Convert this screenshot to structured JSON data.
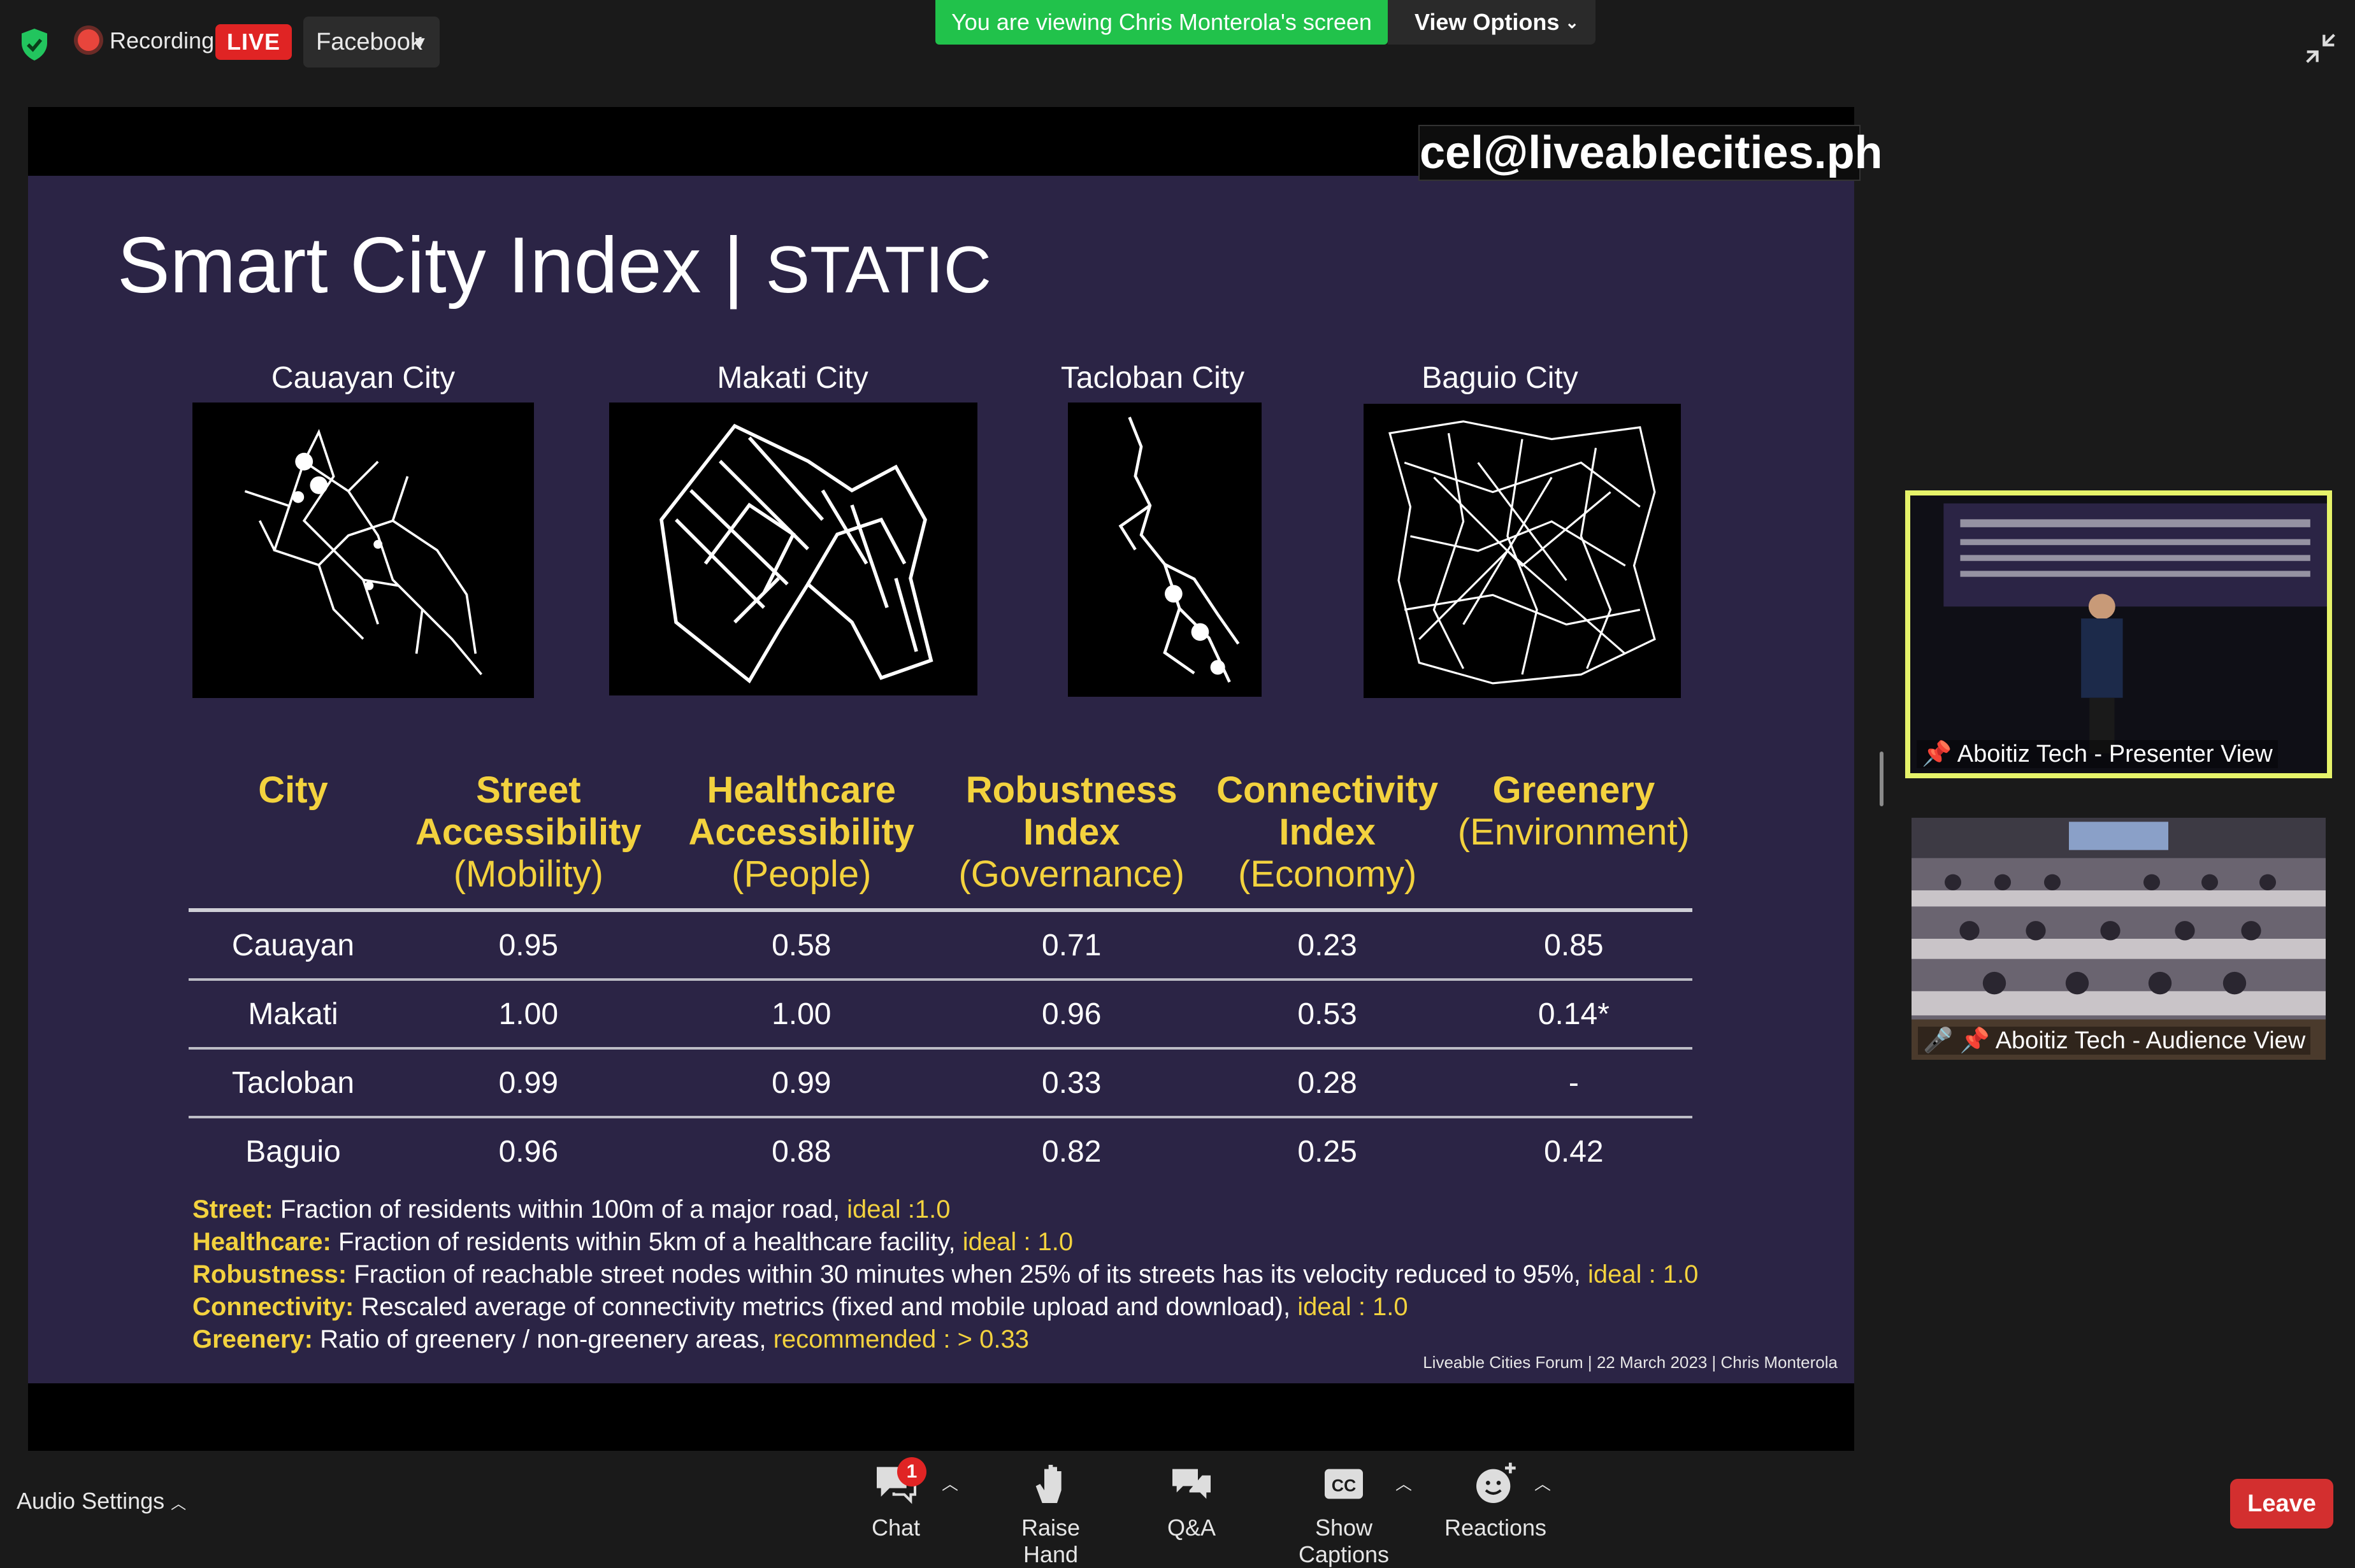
{
  "topbar": {
    "recording_label": "Recording",
    "live_label": "LIVE",
    "stream_target": "Facebook",
    "viewing_banner": "You are viewing Chris Monterola's screen",
    "view_options_label": "View Options"
  },
  "slide": {
    "email": "cel@liveablecities.ph",
    "title_main": "Smart City Index | ",
    "title_sub": "STATIC",
    "maps": [
      {
        "label": "Cauayan City"
      },
      {
        "label": "Makati City"
      },
      {
        "label": "Tacloban City"
      },
      {
        "label": "Baguio City"
      }
    ],
    "table": {
      "headers": [
        {
          "name": "City",
          "unit": ""
        },
        {
          "name": "Street Accessibility",
          "unit": "(Mobility)"
        },
        {
          "name": "Healthcare Accessibility",
          "unit": "(People)"
        },
        {
          "name": "Robustness Index",
          "unit": "(Governance)"
        },
        {
          "name": "Connectivity Index",
          "unit": "(Economy)"
        },
        {
          "name": "Greenery",
          "unit": "(Environment)"
        }
      ],
      "rows": [
        [
          "Cauayan",
          "0.95",
          "0.58",
          "0.71",
          "0.23",
          "0.85"
        ],
        [
          "Makati",
          "1.00",
          "1.00",
          "0.96",
          "0.53",
          "0.14*"
        ],
        [
          "Tacloban",
          "0.99",
          "0.99",
          "0.33",
          "0.28",
          "-"
        ],
        [
          "Baguio",
          "0.96",
          "0.88",
          "0.82",
          "0.25",
          "0.42"
        ]
      ]
    },
    "definitions": [
      {
        "key": "Street:",
        "text": " Fraction of residents within 100m of a major road, ",
        "ideal": "ideal :1.0"
      },
      {
        "key": "Healthcare:",
        "text": " Fraction of residents within 5km of a healthcare facility, ",
        "ideal": "ideal : 1.0"
      },
      {
        "key": "Robustness:",
        "text": " Fraction of reachable street nodes  within 30 minutes when 25% of its streets has its velocity reduced to 95%, ",
        "ideal": "ideal : 1.0"
      },
      {
        "key": "Connectivity:",
        "text": " Rescaled average of connectivity metrics (fixed and mobile upload and download), ",
        "ideal": "ideal : 1.0"
      },
      {
        "key": "Greenery:",
        "text": " Ratio of greenery / non-greenery areas, ",
        "ideal": "recommended : > 0.33"
      }
    ],
    "credit": "Liveable Cities Forum |  22 March 2023  |   Chris Monterola"
  },
  "panels": {
    "presenter_label": "Aboitiz Tech - Presenter View",
    "audience_label": "Aboitiz Tech - Audience View"
  },
  "toolbar": {
    "audio_settings": "Audio Settings",
    "chat": "Chat",
    "chat_badge": "1",
    "raise_hand": "Raise Hand",
    "qa": "Q&A",
    "captions": "Show Captions",
    "reactions": "Reactions",
    "leave": "Leave"
  },
  "colors": {
    "slide_bg": "#2b2445",
    "accent_yellow": "#f3d23e",
    "banner_green": "#21c24b",
    "live_red": "#e02424",
    "presenter_border": "#e6f36a"
  }
}
